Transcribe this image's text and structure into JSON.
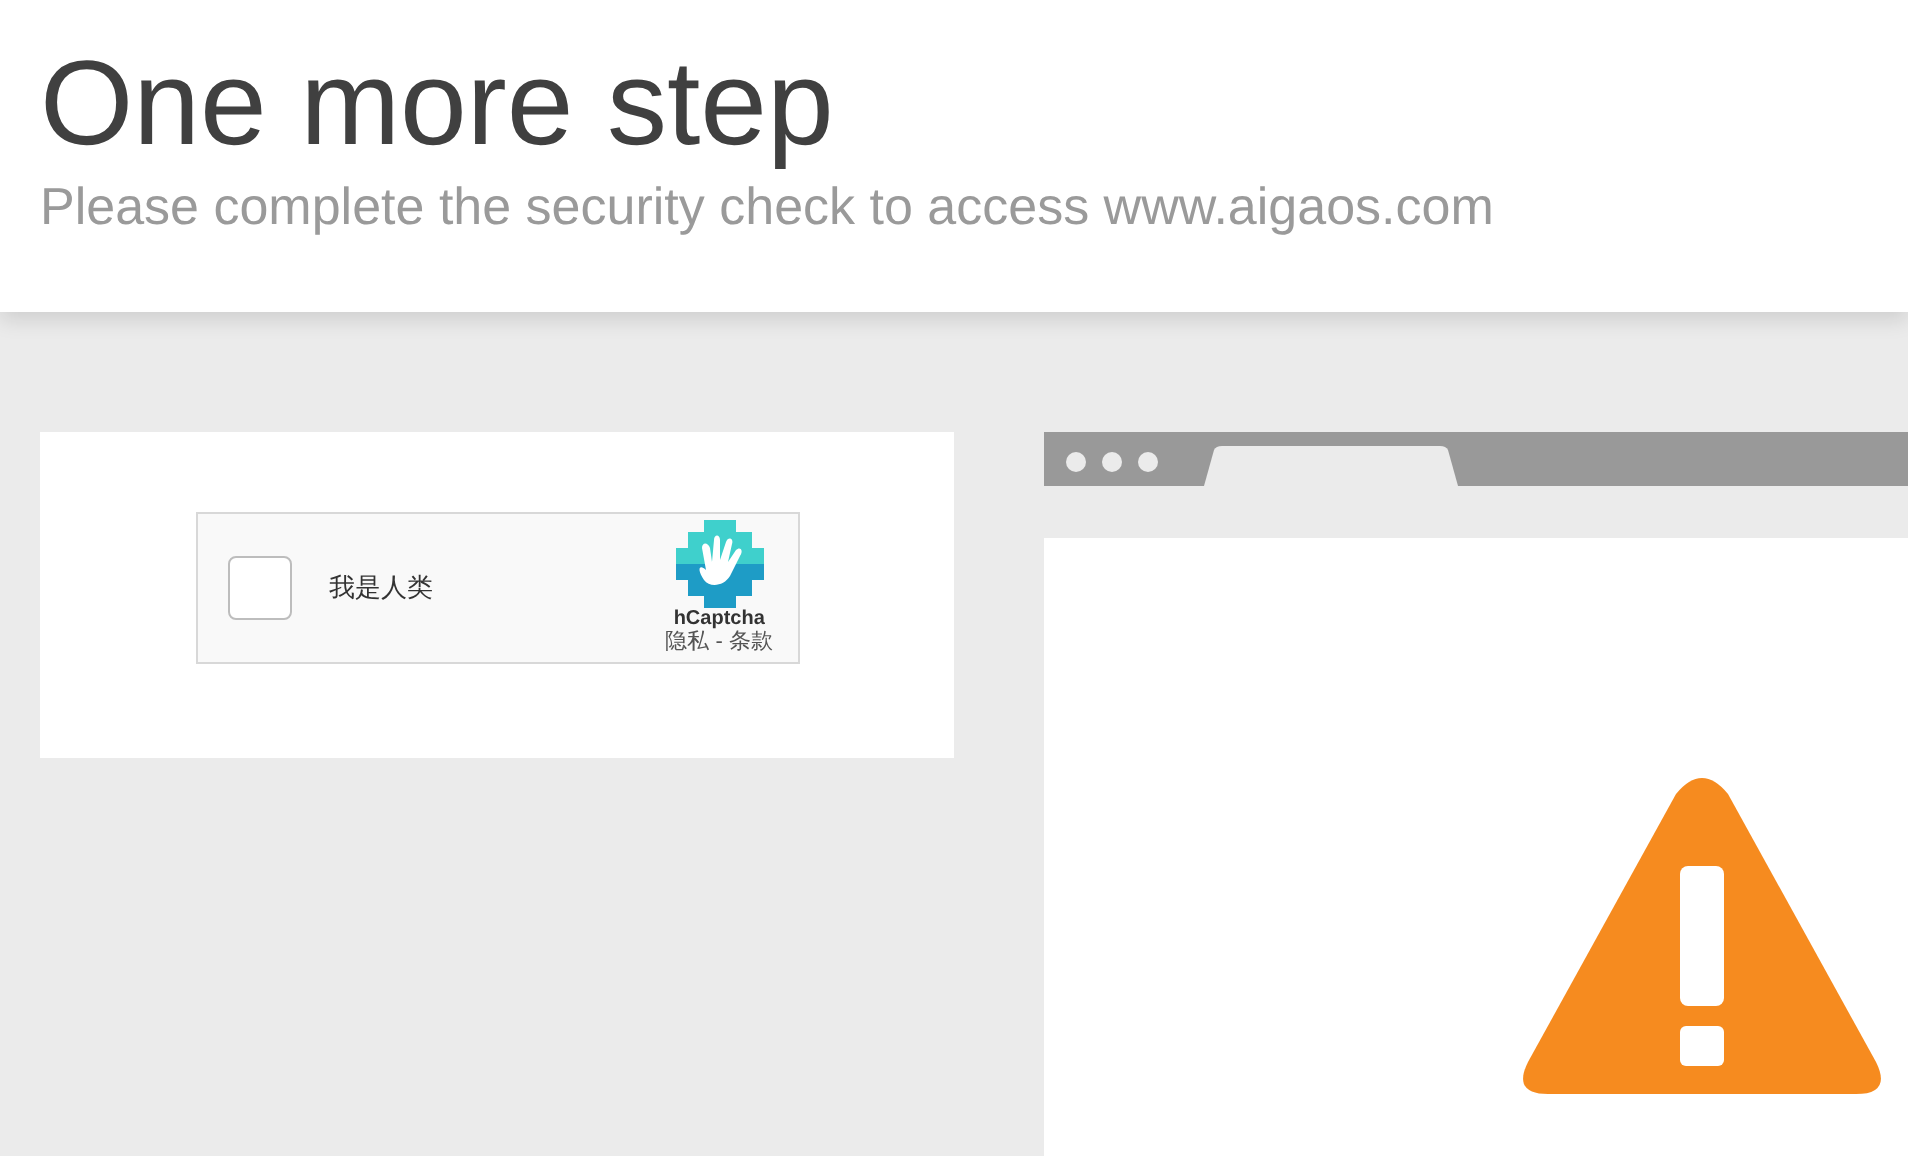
{
  "header": {
    "title": "One more step",
    "subtitle": "Please complete the security check to access www.aigaos.com"
  },
  "captcha": {
    "checked": false,
    "label": "我是人类",
    "brand": "hCaptcha",
    "links": "隐私 - 条款"
  }
}
